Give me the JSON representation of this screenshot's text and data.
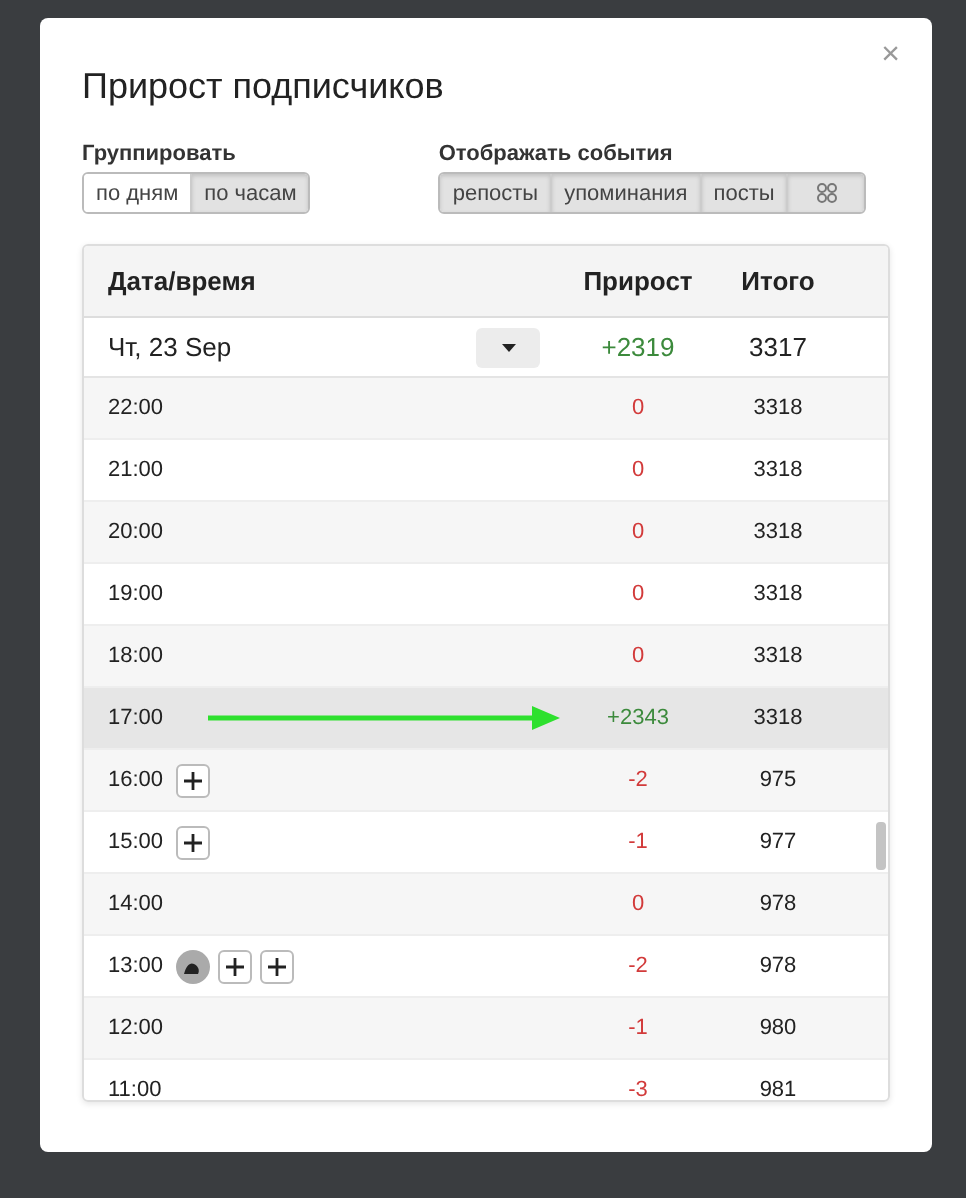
{
  "dialog": {
    "title": "Прирост подписчиков",
    "close": "×"
  },
  "group_by": {
    "label": "Группировать",
    "options": [
      {
        "label": "по дням",
        "selected": false
      },
      {
        "label": "по часам",
        "selected": true
      }
    ]
  },
  "events": {
    "label": "Отображать события",
    "options": [
      {
        "label": "репосты",
        "selected": true,
        "kind": "text"
      },
      {
        "label": "упоминания",
        "selected": true,
        "kind": "text"
      },
      {
        "label": "посты",
        "selected": true,
        "kind": "text"
      },
      {
        "kind": "icon",
        "selected": true
      }
    ]
  },
  "table": {
    "columns": [
      "Дата/время",
      "Прирост",
      "Итого"
    ],
    "day": {
      "date": "Чт, 23 Sep",
      "growth": "+2319",
      "total": "3317",
      "kind": "gain"
    },
    "rows": [
      {
        "time": "22:00",
        "growth": "0",
        "total": "3318",
        "kind": "loss",
        "highlighted": false,
        "arrow": false,
        "icons": []
      },
      {
        "time": "21:00",
        "growth": "0",
        "total": "3318",
        "kind": "loss",
        "highlighted": false,
        "arrow": false,
        "icons": []
      },
      {
        "time": "20:00",
        "growth": "0",
        "total": "3318",
        "kind": "loss",
        "highlighted": false,
        "arrow": false,
        "icons": []
      },
      {
        "time": "19:00",
        "growth": "0",
        "total": "3318",
        "kind": "loss",
        "highlighted": false,
        "arrow": false,
        "icons": []
      },
      {
        "time": "18:00",
        "growth": "0",
        "total": "3318",
        "kind": "loss",
        "highlighted": false,
        "arrow": false,
        "icons": []
      },
      {
        "time": "17:00",
        "growth": "+2343",
        "total": "3318",
        "kind": "gain",
        "highlighted": true,
        "arrow": true,
        "icons": []
      },
      {
        "time": "16:00",
        "growth": "-2",
        "total": "975",
        "kind": "loss",
        "highlighted": false,
        "arrow": false,
        "icons": [
          {
            "kind": "plus"
          }
        ]
      },
      {
        "time": "15:00",
        "growth": "-1",
        "total": "977",
        "kind": "loss",
        "highlighted": false,
        "arrow": false,
        "icons": [
          {
            "kind": "plus"
          }
        ]
      },
      {
        "time": "14:00",
        "growth": "0",
        "total": "978",
        "kind": "loss",
        "highlighted": false,
        "arrow": false,
        "icons": []
      },
      {
        "time": "13:00",
        "growth": "-2",
        "total": "978",
        "kind": "loss",
        "highlighted": false,
        "arrow": false,
        "icons": [
          {
            "kind": "avatar"
          },
          {
            "kind": "plus"
          },
          {
            "kind": "plus"
          }
        ]
      },
      {
        "time": "12:00",
        "growth": "-1",
        "total": "980",
        "kind": "loss",
        "highlighted": false,
        "arrow": false,
        "icons": []
      },
      {
        "time": "11:00",
        "growth": "-3",
        "total": "981",
        "kind": "loss",
        "highlighted": false,
        "arrow": false,
        "icons": []
      }
    ]
  }
}
